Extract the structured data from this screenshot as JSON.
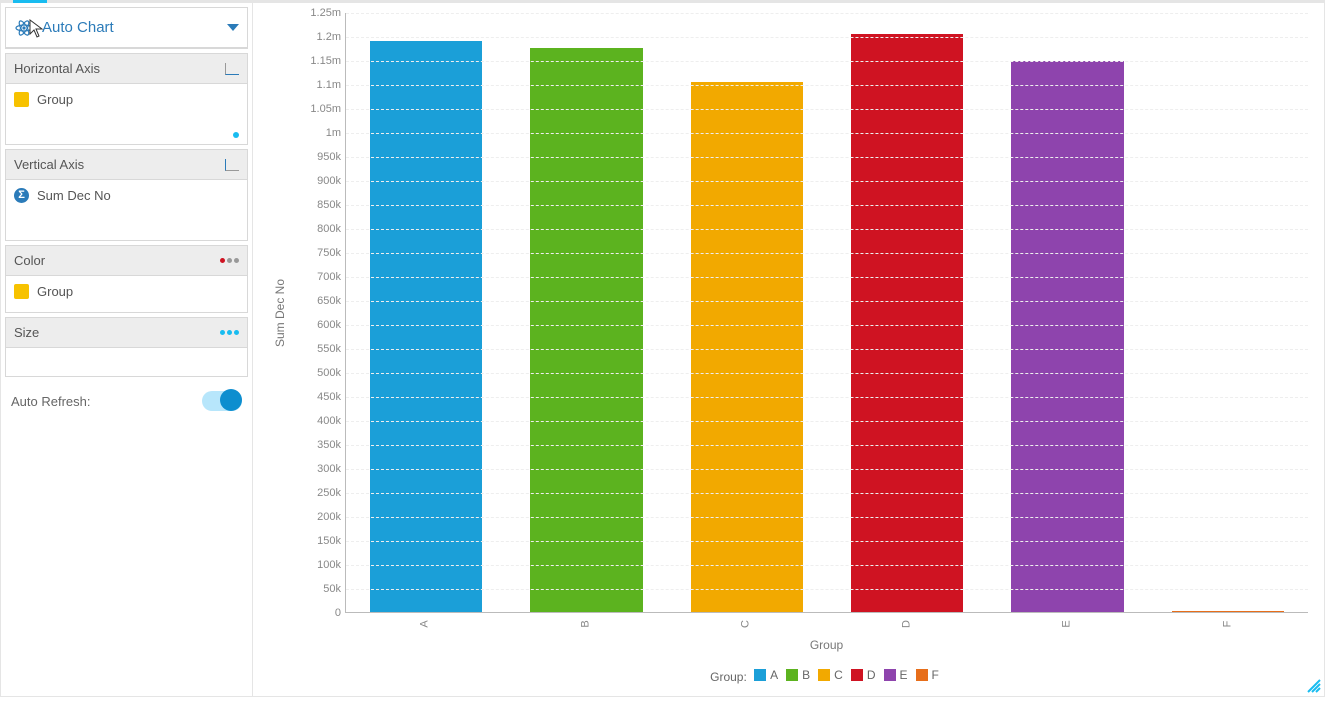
{
  "sidebar": {
    "chart_type_label": "Auto Chart",
    "horizontal_axis": {
      "title": "Horizontal Axis",
      "field": "Group"
    },
    "vertical_axis": {
      "title": "Vertical Axis",
      "field": "Sum Dec No"
    },
    "color": {
      "title": "Color",
      "field": "Group"
    },
    "size": {
      "title": "Size"
    },
    "auto_refresh_label": "Auto Refresh:",
    "auto_refresh_on": true
  },
  "legend_label": "Group:",
  "chart_data": {
    "type": "bar",
    "xlabel": "Group",
    "ylabel": "Sum Dec No",
    "ylim": [
      0,
      1250000
    ],
    "y_ticks": [
      {
        "v": 0,
        "label": "0"
      },
      {
        "v": 50000,
        "label": "50k"
      },
      {
        "v": 100000,
        "label": "100k"
      },
      {
        "v": 150000,
        "label": "150k"
      },
      {
        "v": 200000,
        "label": "200k"
      },
      {
        "v": 250000,
        "label": "250k"
      },
      {
        "v": 300000,
        "label": "300k"
      },
      {
        "v": 350000,
        "label": "350k"
      },
      {
        "v": 400000,
        "label": "400k"
      },
      {
        "v": 450000,
        "label": "450k"
      },
      {
        "v": 500000,
        "label": "500k"
      },
      {
        "v": 550000,
        "label": "550k"
      },
      {
        "v": 600000,
        "label": "600k"
      },
      {
        "v": 650000,
        "label": "650k"
      },
      {
        "v": 700000,
        "label": "700k"
      },
      {
        "v": 750000,
        "label": "750k"
      },
      {
        "v": 800000,
        "label": "800k"
      },
      {
        "v": 850000,
        "label": "850k"
      },
      {
        "v": 900000,
        "label": "900k"
      },
      {
        "v": 950000,
        "label": "950k"
      },
      {
        "v": 1000000,
        "label": "1m"
      },
      {
        "v": 1050000,
        "label": "1.05m"
      },
      {
        "v": 1100000,
        "label": "1.1m"
      },
      {
        "v": 1150000,
        "label": "1.15m"
      },
      {
        "v": 1200000,
        "label": "1.2m"
      },
      {
        "v": 1250000,
        "label": "1.25m"
      }
    ],
    "categories": [
      "A",
      "B",
      "C",
      "D",
      "E",
      "F"
    ],
    "values": [
      1190000,
      1175000,
      1105000,
      1205000,
      1148000,
      3000
    ],
    "colors": [
      "#1b9fd8",
      "#5cb31f",
      "#f2a900",
      "#cf1322",
      "#8e44ad",
      "#e76e1a"
    ]
  }
}
